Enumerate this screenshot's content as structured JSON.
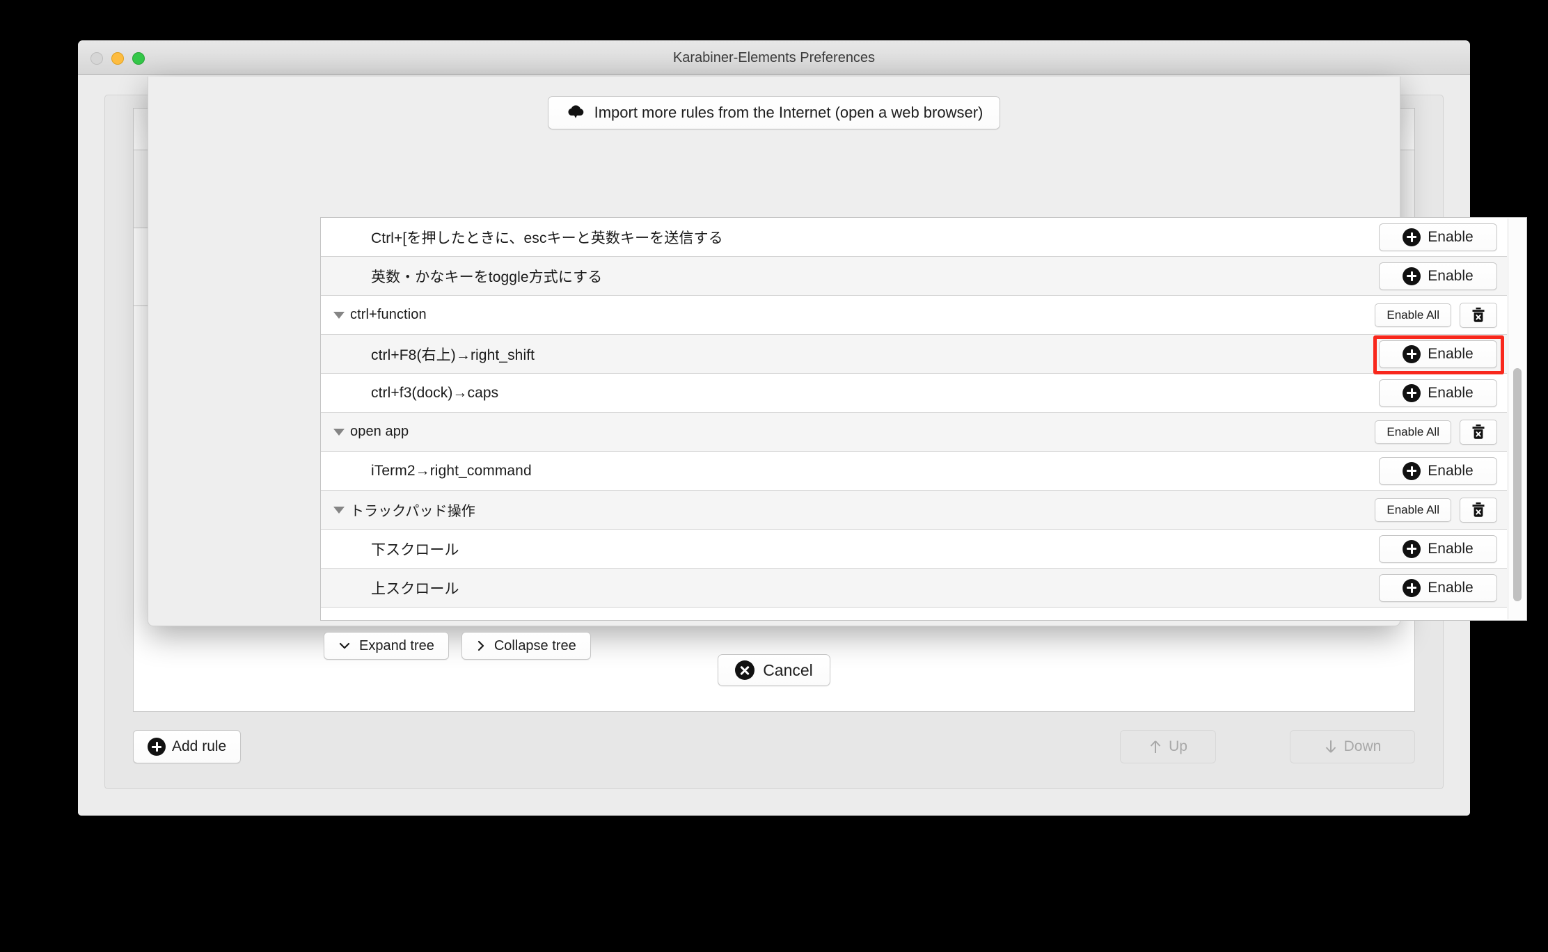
{
  "window": {
    "title": "Karabiner-Elements Preferences",
    "traffic_lights": [
      "close-button",
      "minimize-button",
      "zoom-button"
    ]
  },
  "sheet": {
    "import_button": {
      "label": "Import more rules from the Internet (open a web browser)",
      "icon": "cloud-download-icon"
    },
    "rows": [
      {
        "type": "rule",
        "label": "Ctrl+[を押したときに、escキーと英数キーを送信する",
        "action": "Enable",
        "shade": "white",
        "highlighted": false
      },
      {
        "type": "rule",
        "label": "英数・かなキーをtoggle方式にする",
        "action": "Enable",
        "shade": "alt",
        "highlighted": false
      },
      {
        "type": "group",
        "label": "ctrl+function",
        "action": "Enable All",
        "shade": "white",
        "delete": true
      },
      {
        "type": "rule",
        "label": "ctrl+F8(右上)→right_shift",
        "action": "Enable",
        "shade": "alt",
        "highlighted": true
      },
      {
        "type": "rule",
        "label": "ctrl+f3(dock)→caps",
        "action": "Enable",
        "shade": "white",
        "highlighted": false
      },
      {
        "type": "group",
        "label": "open app",
        "action": "Enable All",
        "shade": "alt",
        "delete": true
      },
      {
        "type": "rule",
        "label": "iTerm2→right_command",
        "action": "Enable",
        "shade": "white",
        "highlighted": false
      },
      {
        "type": "group",
        "label": "トラックパッド操作",
        "action": "Enable All",
        "shade": "alt",
        "delete": true
      },
      {
        "type": "rule",
        "label": "下スクロール",
        "action": "Enable",
        "shade": "white",
        "highlighted": false
      },
      {
        "type": "rule",
        "label": "上スクロール",
        "action": "Enable",
        "shade": "alt",
        "highlighted": false
      }
    ],
    "expand_button": {
      "label": "Expand tree",
      "icon": "chevron-down-icon"
    },
    "collapse_button": {
      "label": "Collapse tree",
      "icon": "chevron-right-icon"
    },
    "cancel_button": {
      "label": "Cancel",
      "icon": "circle-x-icon"
    }
  },
  "background_window": {
    "add_rule_button": {
      "label": "Add rule",
      "icon": "circle-plus-icon"
    },
    "up_button": {
      "label": "Up",
      "icon": "arrow-up-icon",
      "enabled": false
    },
    "down_button": {
      "label": "Down",
      "icon": "arrow-down-icon",
      "enabled": false
    }
  },
  "colors": {
    "highlight": "#f8271c",
    "window_bg": "#ececec",
    "sheet_bg": "#eeeeee"
  }
}
